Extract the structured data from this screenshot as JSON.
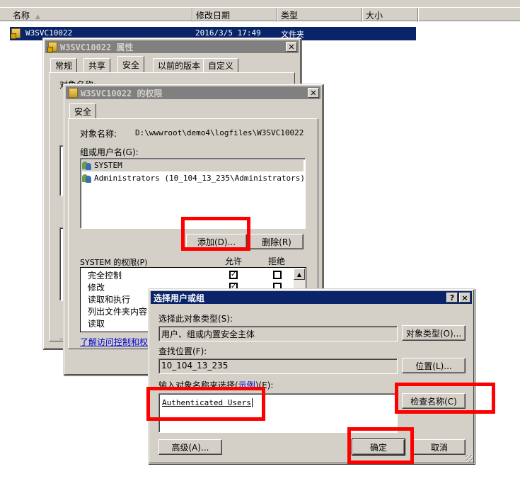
{
  "explorer": {
    "columns": [
      {
        "label": "名称",
        "sort_icon": "sort-ascending-icon"
      },
      {
        "label": "修改日期"
      },
      {
        "label": "类型"
      },
      {
        "label": "大小"
      }
    ],
    "selected_row": {
      "name": "W3SVC10022",
      "modified": "2016/3/5 17:49",
      "type": "文件夹"
    }
  },
  "properties_dialog": {
    "title": "W3SVC10022 属性",
    "tabs": [
      "常规",
      "共享",
      "安全",
      "以前的版本",
      "自定义"
    ],
    "active_tab": "安全",
    "obscured_object_label": "对象名称:",
    "obscured_object_value": "D:\\wwwroot\\demo4\\logfiles\\W3SVC10022"
  },
  "permissions_dialog": {
    "title": "W3SVC10022 的权限",
    "tab": "安全",
    "object_name_label": "对象名称:",
    "object_name_value": "D:\\wwwroot\\demo4\\logfiles\\W3SVC10022",
    "group_label": "组或用户名(G):",
    "users": [
      {
        "name": "SYSTEM"
      },
      {
        "name": "Administrators (10_104_13_235\\Administrators)"
      }
    ],
    "add_button": "添加(D)...",
    "remove_button": "删除(R)",
    "permissions_label": "SYSTEM 的权限(P)",
    "allow_header": "允许",
    "deny_header": "拒绝",
    "permissions": [
      {
        "name": "完全控制",
        "allow": true,
        "deny": false
      },
      {
        "name": "修改",
        "allow": true,
        "deny": false
      },
      {
        "name": "读取和执行",
        "allow": true,
        "deny": false
      },
      {
        "name": "列出文件夹内容",
        "allow": true,
        "deny": false
      },
      {
        "name": "读取",
        "allow": true,
        "deny": false
      }
    ],
    "learn_link": "了解访问控制和权限"
  },
  "select_dialog": {
    "title": "选择用户或组",
    "help_button": "?",
    "close_button": "×",
    "object_type_label": "选择此对象类型(S):",
    "object_type_value": "用户、组或内置安全主体",
    "object_type_button": "对象类型(O)...",
    "location_label": "查找位置(F):",
    "location_value": "10_104_13_235",
    "location_button": "位置(L)...",
    "names_label_prefix": "输入对象名称来选择(",
    "names_label_link": "示例",
    "names_label_suffix": ")(E):",
    "names_value": "Authenticated Users",
    "check_names_button": "检查名称(C)",
    "advanced_button": "高级(A)...",
    "ok_button": "确定",
    "cancel_button": "取消"
  },
  "annotation_color": "#ff0000"
}
